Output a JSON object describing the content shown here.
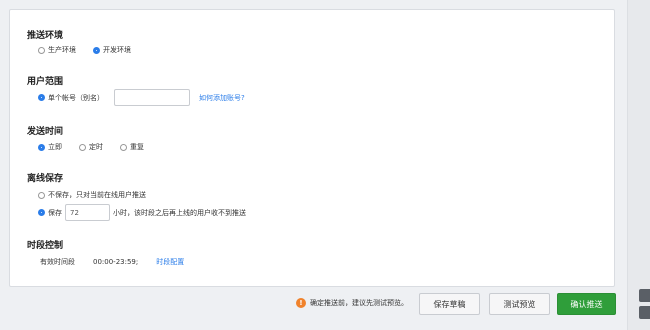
{
  "sections": {
    "env": {
      "title": "推送环境",
      "options": [
        {
          "label": "生产环境",
          "checked": false
        },
        {
          "label": "开发环境",
          "checked": true
        }
      ]
    },
    "users": {
      "title": "用户范围",
      "option_label": "单个帐号（别名）",
      "input_value": "",
      "help_link": "如何添加账号?"
    },
    "time": {
      "title": "发送时间",
      "options": [
        {
          "label": "立即",
          "checked": true
        },
        {
          "label": "定时",
          "checked": false
        },
        {
          "label": "重复",
          "checked": false
        }
      ]
    },
    "offline": {
      "title": "离线保存",
      "no_save_label": "不保存，只对当前在线用户推送",
      "save_label": "保存",
      "hours_value": "72",
      "hours_suffix": "小时，该时段之后再上线的用户收不到推送"
    },
    "period": {
      "title": "时段控制",
      "label": "有效时间段",
      "value": "00:00-23:59;",
      "config_link": "时段配置"
    }
  },
  "footer": {
    "warning_icon": "!",
    "warning_text": "确定推送前，建议先测试预览。",
    "save_draft": "保存草稿",
    "test_preview": "测试预览",
    "confirm_push": "确认推送"
  },
  "colors": {
    "accent": "#2b7de9",
    "primary_button": "#2f9e3a",
    "warning": "#f0822b"
  }
}
